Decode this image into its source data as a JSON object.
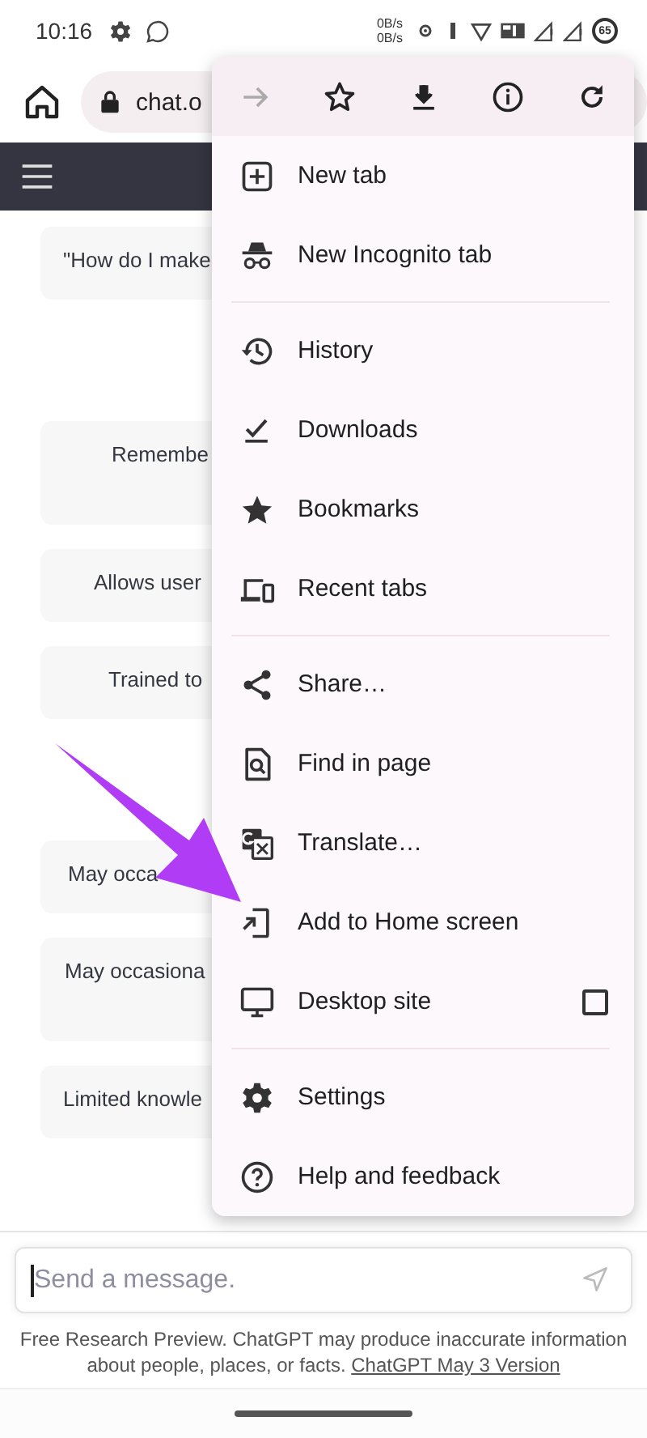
{
  "status_bar": {
    "time": "10:16",
    "speed_up": "0B/s",
    "speed_down": "0B/s",
    "battery": "65"
  },
  "address_bar": {
    "url": "chat.o"
  },
  "chat": {
    "sections": [
      {
        "cards": [
          "\"How do I make"
        ]
      },
      {
        "cards": [
          "Remembe",
          "Allows user",
          "Trained to"
        ]
      },
      {
        "cards": [
          "May occa",
          "May occasiona",
          "Limited knowle"
        ]
      }
    ],
    "input": {
      "placeholder": "Send a message."
    },
    "disclaimer": "Free Research Preview. ChatGPT may produce inaccurate information about people, places, or facts.",
    "version_link": "ChatGPT May 3 Version"
  },
  "menu": {
    "toolbar": [
      {
        "disabled": true
      },
      {
        "disabled": false
      },
      {
        "disabled": false
      },
      {
        "disabled": false
      },
      {
        "disabled": false
      }
    ],
    "groups": [
      {
        "items": [
          {
            "label": "New tab"
          },
          {
            "label": "New Incognito tab"
          }
        ]
      },
      {
        "items": [
          {
            "label": "History"
          },
          {
            "label": "Downloads"
          },
          {
            "label": "Bookmarks"
          },
          {
            "label": "Recent tabs"
          }
        ]
      },
      {
        "items": [
          {
            "label": "Share…"
          },
          {
            "label": "Find in page"
          },
          {
            "label": "Translate…"
          },
          {
            "label": "Add to Home screen"
          },
          {
            "label": "Desktop site",
            "checked": false
          }
        ]
      },
      {
        "items": [
          {
            "label": "Settings"
          },
          {
            "label": "Help and feedback"
          }
        ]
      }
    ]
  }
}
